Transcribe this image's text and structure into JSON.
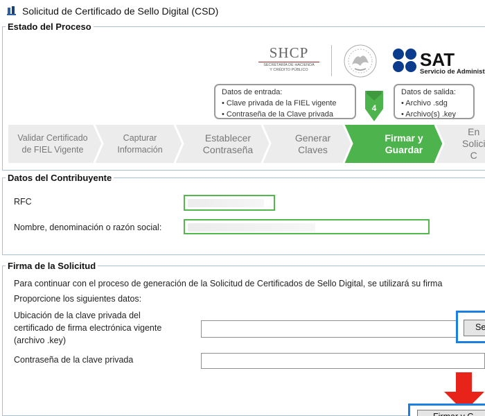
{
  "window": {
    "title": "Solicitud de Certificado de Sello Digital (CSD)"
  },
  "estado": {
    "legend": "Estado del Proceso",
    "shcp": {
      "name": "SHCP",
      "subtitle_1": "SECRETARÍA DE HACIENDA",
      "subtitle_2": "Y CRÉDITO PÚBLICO"
    },
    "sat": {
      "name": "SAT",
      "subtitle": "Servicio de Administra"
    },
    "entrada": {
      "title": "Datos de entrada:",
      "items": [
        "• Clave privada de la FIEL vigente",
        "• Contraseña de la Clave privada"
      ]
    },
    "salida": {
      "title": "Datos de salida:",
      "items": [
        "• Archivo .sdg",
        "• Archivo(s) .key"
      ]
    },
    "current_step": "4",
    "steps": [
      {
        "line1": "Validar Certificado",
        "line2": "de FIEL Vigente"
      },
      {
        "line1": "Capturar",
        "line2": "Información"
      },
      {
        "line1": "Establecer",
        "line2": "Contraseña"
      },
      {
        "line1": "Generar",
        "line2": "Claves"
      },
      {
        "line1": "Firmar y",
        "line2": "Guardar"
      },
      {
        "line1": "En",
        "line2": "Solici",
        "line3": "C"
      }
    ]
  },
  "contribuyente": {
    "legend": "Datos del Contribuyente",
    "rfc_label": "RFC",
    "nombre_label": "Nombre, denominación o razón social:"
  },
  "firma": {
    "legend": "Firma de la Solicitud",
    "intro": "Para continuar con el proceso de generación de la Solicitud de Certificados de Sello Digital, se utilizará su firma",
    "proporcione": "Proporcione los siguientes datos:",
    "ubicacion_label": "Ubicación de la clave privada del certificado de firma electrónica vigente (archivo .key)",
    "password_label": "Contraseña de la clave privada",
    "select_button": "Se",
    "firmar_button": "Firmar y G"
  },
  "colors": {
    "active_step": "#4db34d",
    "highlight": "#1a7fe0",
    "arrow": "#e8231a",
    "field_border": "#52b84e"
  }
}
